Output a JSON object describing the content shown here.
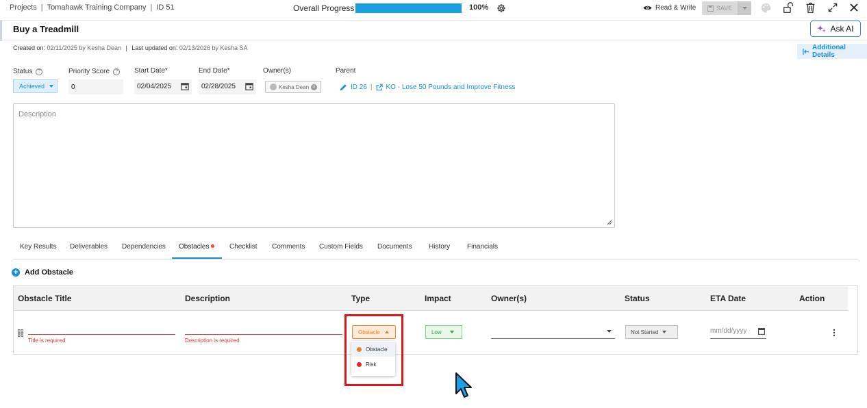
{
  "breadcrumb": {
    "projects": "Projects",
    "company": "Tomahawk Training Company",
    "id": "ID 51"
  },
  "progress": {
    "label": "Overall Progress",
    "value": 100,
    "value_text": "100%"
  },
  "access": {
    "label": "Read & Write",
    "icon": "eye-icon"
  },
  "toolbar": {
    "save_label": "SAVE",
    "ask_ai_label": "Ask AI"
  },
  "page": {
    "title": "Buy a Treadmill",
    "created_label": "Created on:",
    "created_value": "02/11/2025 by Kesha Dean",
    "updated_label": "Last updated on:",
    "updated_value": "02/13/2026 by Kesha SA",
    "additional_details": "Additional Details"
  },
  "fields": {
    "status_label": "Status",
    "status_value": "Achieved",
    "priority_label": "Priority Score",
    "priority_value": "0",
    "start_label": "Start Date*",
    "start_value": "02/04/2025",
    "end_label": "End Date*",
    "end_value": "02/28/2025",
    "owners_label": "Owner(s)",
    "owner_chip": "Kesha Dean",
    "parent_label": "Parent",
    "parent_id": "ID 26",
    "parent_sep": "|",
    "parent_link": "KO - Lose 50 Pounds and Improve Fitness"
  },
  "description": {
    "placeholder": "Description"
  },
  "tabs": [
    "Key Results",
    "Deliverables",
    "Dependencies",
    "Obstacles",
    "Checklist",
    "Comments",
    "Custom Fields",
    "Documents",
    "History",
    "Financials"
  ],
  "active_tab": "Obstacles",
  "obstacles": {
    "add_label": "Add Obstacle",
    "columns": [
      "Obstacle Title",
      "Description",
      "Type",
      "Impact",
      "Owner(s)",
      "Status",
      "ETA Date",
      "Action"
    ],
    "row": {
      "title_error": "Title is required",
      "description_error": "Description is required",
      "type_value": "Obstacle",
      "impact_value": "Low",
      "status_value": "Not Started",
      "eta_placeholder": "mm/dd/yyyy"
    },
    "type_options": [
      {
        "label": "Obstacle",
        "color": "#ef7d22"
      },
      {
        "label": "Risk",
        "color": "#e02b2b"
      }
    ]
  },
  "colors": {
    "accent": "#1a8fd8",
    "error": "#d53a3a",
    "highlight": "#e0141c"
  }
}
